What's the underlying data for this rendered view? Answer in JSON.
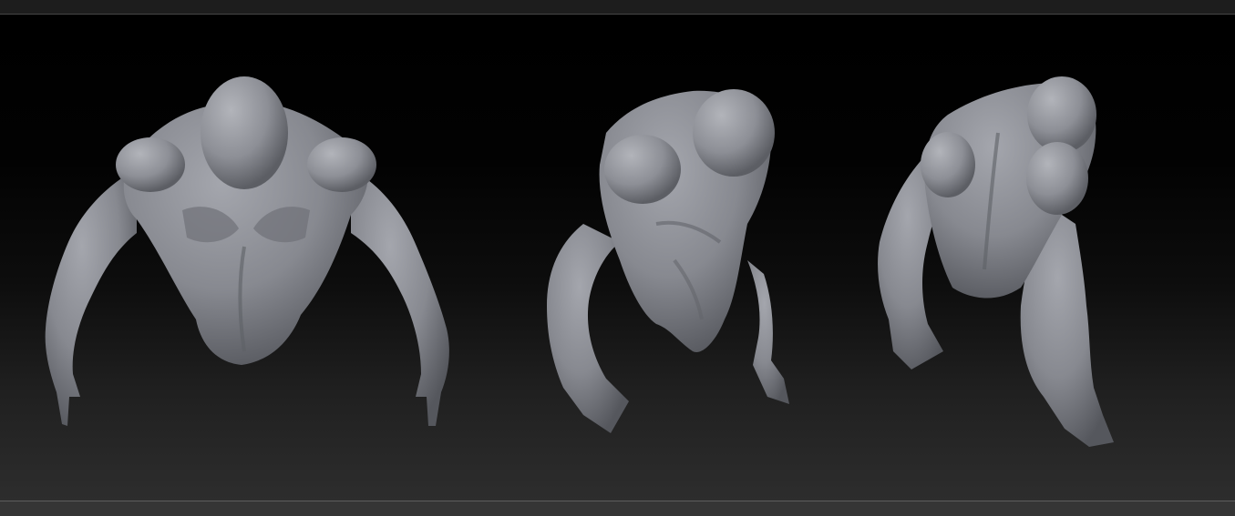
{
  "window": {
    "title": ""
  },
  "viewport": {
    "colors": {
      "background_top": "#000000",
      "background_bottom": "#2d2d2d",
      "mesh": "#8a8c93",
      "mesh_shadow": "#4f5157",
      "rule": "#474747"
    },
    "models": [
      {
        "id": "front",
        "icon": "sculpt-torso-front-icon"
      },
      {
        "id": "three-quarter",
        "icon": "sculpt-torso-three-quarter-icon"
      },
      {
        "id": "back",
        "icon": "sculpt-torso-back-icon"
      }
    ]
  }
}
